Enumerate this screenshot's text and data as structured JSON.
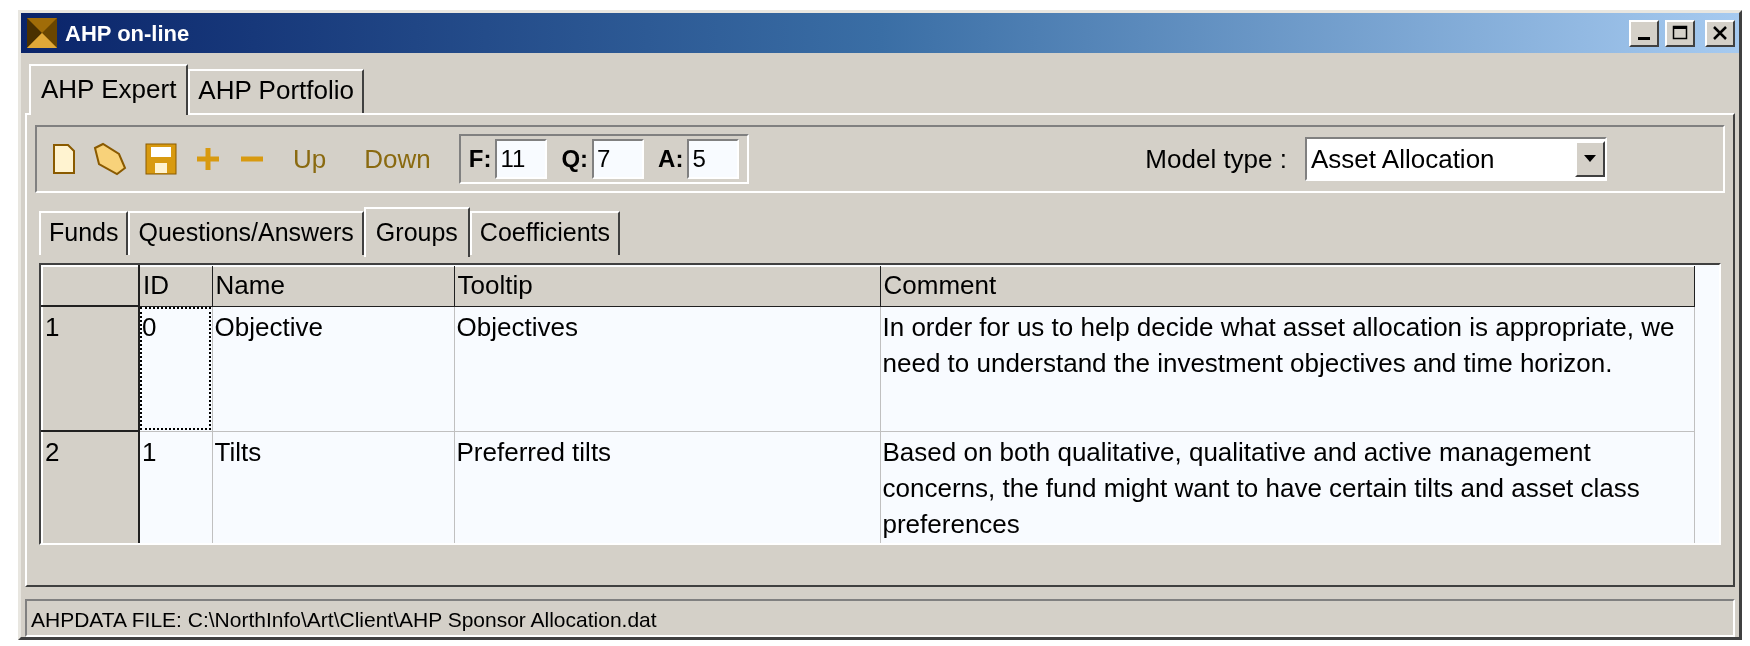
{
  "window": {
    "title": "AHP on-line"
  },
  "tabs": [
    {
      "label": "AHP Expert",
      "selected": true
    },
    {
      "label": "AHP Portfolio",
      "selected": false
    }
  ],
  "toolbar": {
    "buttons": [
      {
        "kind": "new"
      },
      {
        "kind": "open"
      },
      {
        "kind": "save"
      },
      {
        "kind": "add"
      },
      {
        "kind": "remove"
      },
      {
        "kind": "text",
        "label": "Up"
      },
      {
        "kind": "text",
        "label": "Down"
      }
    ],
    "counts": [
      {
        "label": "F:",
        "value": "11"
      },
      {
        "label": "Q:",
        "value": "7"
      },
      {
        "label": "A:",
        "value": "5"
      }
    ],
    "model_type": {
      "label": "Model type :",
      "value": "Asset Allocation"
    }
  },
  "sub_tabs": [
    {
      "label": "Funds",
      "selected": false
    },
    {
      "label": "Questions/Answers",
      "selected": false
    },
    {
      "label": "Groups",
      "selected": true
    },
    {
      "label": "Coefficients",
      "selected": false
    }
  ],
  "table": {
    "columns": [
      "ID",
      "Name",
      "Tooltip",
      "Comment"
    ],
    "rows": [
      {
        "number": "1",
        "cells": [
          "0",
          "Objective",
          "Objectives",
          "In order for us to help decide what asset allocation is appropriate, we need to understand the investment objectives and time horizon."
        ],
        "focused": true
      },
      {
        "number": "2",
        "cells": [
          "1",
          "Tilts",
          "Preferred tilts",
          "Based on both qualitative, qualitative and active management concerns, the fund might want to have certain tilts and asset class preferences"
        ],
        "focused": false
      }
    ]
  },
  "status_bar": "AHPDATA FILE: C:\\NorthInfo\\Art\\Client\\AHP Sponsor Allocation.dat"
}
